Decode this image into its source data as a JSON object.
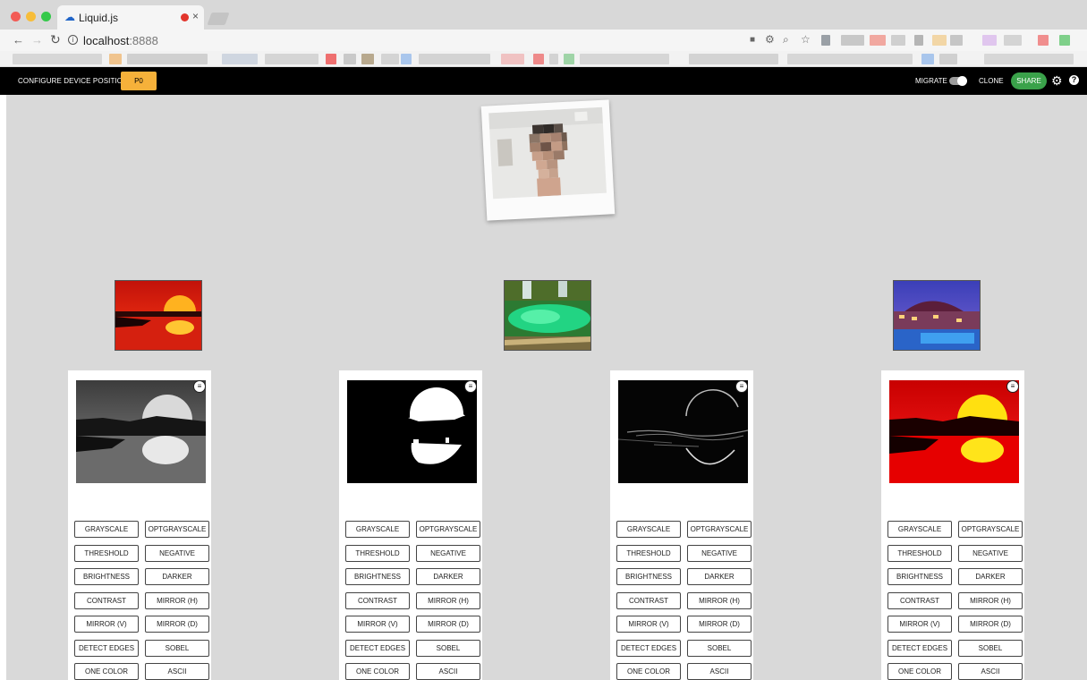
{
  "browser": {
    "tab_title": "Liquid.js",
    "tab_close": "×",
    "url_host": "localhost",
    "url_port": ":8888"
  },
  "toolbar": {
    "configure_label": "CONFIGURE DEVICE POSITION",
    "position_button": "P0",
    "migrate_label": "MIGRATE",
    "migrate_on": true,
    "clone_label": "CLONE",
    "share_button": "SHARE"
  },
  "filters": [
    "GRAYSCALE",
    "OPTGRAYSCALE",
    "THRESHOLD",
    "NEGATIVE",
    "BRIGHTNESS",
    "DARKER",
    "CONTRAST",
    "MIRROR (H)",
    "MIRROR (V)",
    "MIRROR (D)",
    "DETECT EDGES",
    "SOBEL",
    "ONE COLOR",
    "ASCII"
  ],
  "cards": [
    {
      "id": "grayscale",
      "filters": [
        "GRAYSCALE",
        "OPTGRAYSCALE",
        "THRESHOLD",
        "NEGATIVE",
        "BRIGHTNESS",
        "DARKER",
        "CONTRAST",
        "MIRROR (H)",
        "MIRROR (V)",
        "MIRROR (D)",
        "DETECT EDGES",
        "SOBEL",
        "ONE COLOR",
        "ASCII"
      ]
    },
    {
      "id": "threshold",
      "filters": [
        "GRAYSCALE",
        "OPTGRAYSCALE",
        "THRESHOLD",
        "NEGATIVE",
        "BRIGHTNESS",
        "DARKER",
        "CONTRAST",
        "MIRROR (H)",
        "MIRROR (V)",
        "MIRROR (D)",
        "DETECT EDGES",
        "SOBEL",
        "ONE COLOR",
        "ASCII"
      ]
    },
    {
      "id": "edges",
      "filters": [
        "GRAYSCALE",
        "OPTGRAYSCALE",
        "THRESHOLD",
        "NEGATIVE",
        "BRIGHTNESS",
        "DARKER",
        "CONTRAST",
        "MIRROR (H)",
        "MIRROR (V)",
        "MIRROR (D)",
        "DETECT EDGES",
        "SOBEL",
        "ONE COLOR",
        "ASCII"
      ]
    },
    {
      "id": "color",
      "filters": [
        "GRAYSCALE",
        "OPTGRAYSCALE",
        "THRESHOLD",
        "NEGATIVE",
        "BRIGHTNESS",
        "DARKER",
        "CONTRAST",
        "MIRROR (H)",
        "MIRROR (V)",
        "MIRROR (D)",
        "DETECT EDGES",
        "SOBEL",
        "ONE COLOR",
        "ASCII"
      ]
    }
  ],
  "colors": {
    "accent_orange": "#f6b13a",
    "share_green": "#3aa24a",
    "workspace_bg": "#d9d9d9",
    "toolbar_bg": "#000000"
  }
}
